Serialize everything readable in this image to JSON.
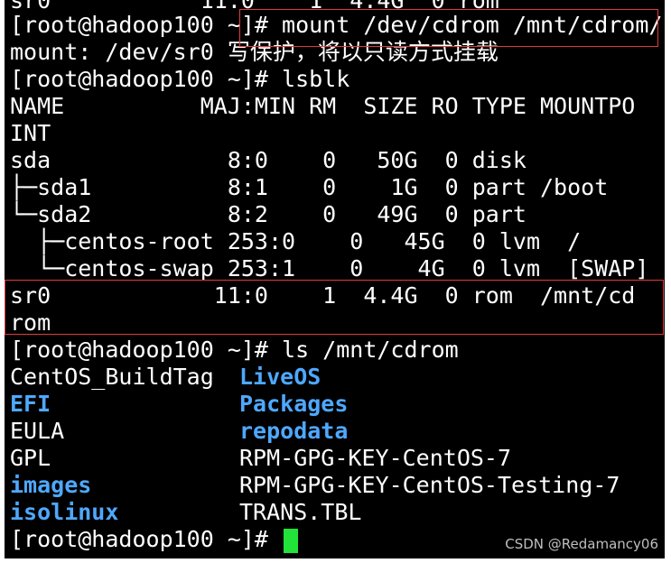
{
  "terminal": {
    "lines": [
      "sr0           11:0    1  4.4G  0 rom",
      "[root@hadoop100 ~]# mount /dev/cdrom /mnt/cdrom/",
      "mount: /dev/sr0 写保护，将以只读方式挂载",
      "[root@hadoop100 ~]# lsblk",
      "NAME          MAJ:MIN RM  SIZE RO TYPE MOUNTPO",
      "INT",
      "sda             8:0    0   50G  0 disk",
      "├─sda1          8:1    0    1G  0 part /boot",
      "└─sda2          8:2    0   49G  0 part",
      "  ├─centos-root 253:0    0   45G  0 lvm  /",
      "  └─centos-swap 253:1    0    4G  0 lvm  [SWAP]",
      "sr0            11:0    1  4.4G  0 rom  /mnt/cd",
      "rom",
      "[root@hadoop100 ~]# ls /mnt/cdrom"
    ],
    "ls_rows": [
      {
        "left": "CentOS_BuildTag",
        "right": "LiveOS"
      },
      {
        "left": "EFI",
        "right": "Packages"
      },
      {
        "left": "EULA",
        "right": "repodata"
      },
      {
        "left": "GPL",
        "right": "RPM-GPG-KEY-CentOS-7"
      },
      {
        "left": "images",
        "right": "RPM-GPG-KEY-CentOS-Testing-7"
      },
      {
        "left": "isolinux",
        "right": "TRANS.TBL"
      }
    ],
    "final_prompt": "[root@hadoop100 ~]# ",
    "colors": {
      "background": "#000000",
      "text": "#ffffff",
      "directory": "#4ea8ff",
      "cursor": "#22e23a",
      "highlight_border": "#e4393c"
    }
  },
  "watermark": "CSDN @Redamancy06"
}
